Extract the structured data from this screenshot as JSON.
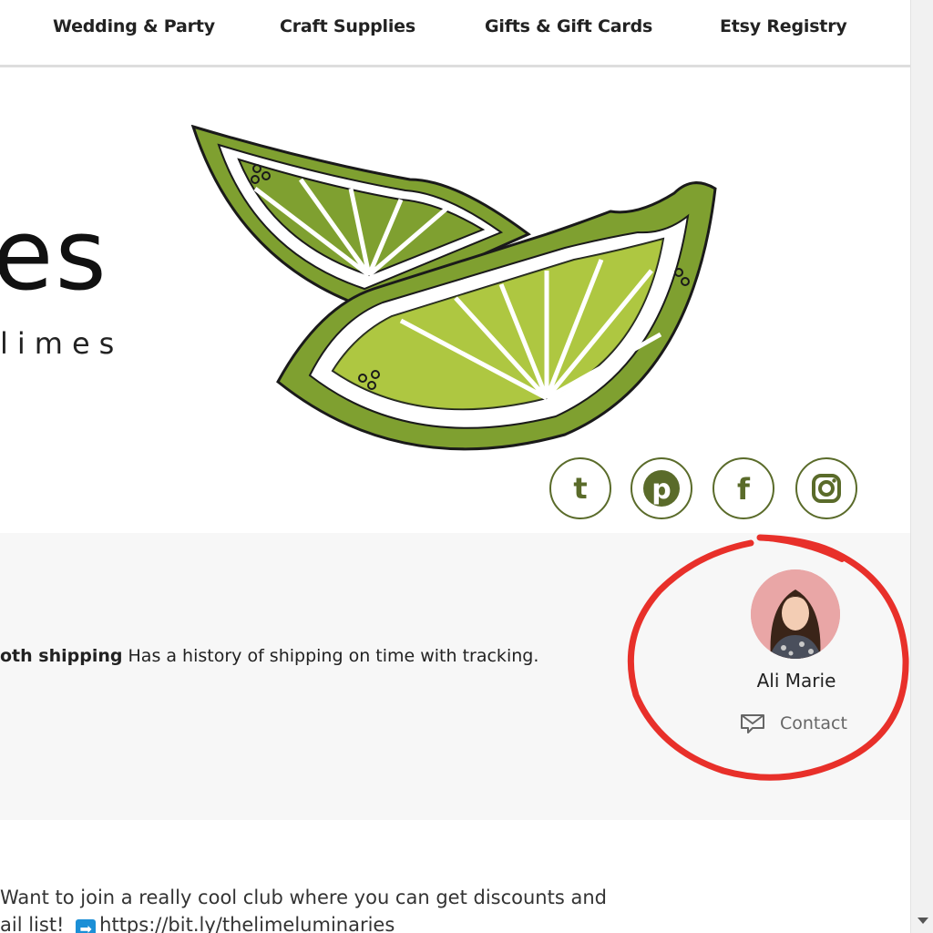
{
  "nav": {
    "items": [
      "Wedding & Party",
      "Craft Supplies",
      "Gifts & Gift Cards",
      "Etsy Registry"
    ]
  },
  "banner": {
    "title_fragment": "es",
    "subtitle_fragment": "limes",
    "social": [
      {
        "name": "tumblr-icon",
        "glyph": "t"
      },
      {
        "name": "pinterest-icon",
        "glyph": "p"
      },
      {
        "name": "facebook-icon",
        "glyph": "f"
      },
      {
        "name": "instagram-icon",
        "glyph": "ig"
      }
    ],
    "accent_color": "#5a6b2a",
    "lime_colors": {
      "rind": "#7fa030",
      "flesh": "#c8dc4a",
      "pith": "#ffffff",
      "outline": "#1a1a1a"
    }
  },
  "shop_info": {
    "shipping_bold": "oth shipping",
    "shipping_text": " Has a history of shipping on time with tracking."
  },
  "owner": {
    "name": "Ali Marie",
    "contact_label": "Contact"
  },
  "annotation": {
    "color": "#e8302a"
  },
  "announcement": {
    "line1": "Want to join a really cool club where you can get discounts and",
    "line2_prefix": "ail list! ",
    "arrow": "➡",
    "url": "https://bit.ly/thelimeluminaries"
  }
}
